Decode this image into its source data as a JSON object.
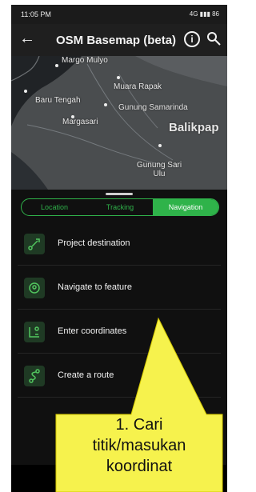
{
  "status": {
    "time": "11:05 PM",
    "right": "4G ▮▮▮ 86"
  },
  "appbar": {
    "back_icon": "arrow-left",
    "title": "OSM Basemap (beta)",
    "info_icon": "info-icon",
    "search_icon": "search-icon"
  },
  "map": {
    "labels": [
      "Margo Mulyo",
      "Muara Rapak",
      "Baru Tengah",
      "Gunung Samarinda",
      "Margasari",
      "Balikpap",
      "Gunung Sari Ulu"
    ]
  },
  "tabs": [
    "Location",
    "Tracking",
    "Navigation"
  ],
  "active_tab": "Navigation",
  "menu": [
    {
      "label": "Project destination",
      "icon": "project-destination-icon"
    },
    {
      "label": "Navigate to feature",
      "icon": "navigate-to-feature-icon"
    },
    {
      "label": "Enter coordinates",
      "icon": "enter-coordinates-icon"
    },
    {
      "label": "Create a route",
      "icon": "create-route-icon"
    }
  ],
  "annotation": {
    "lines": [
      "1. Cari",
      "titik/masukan",
      "koordinat"
    ]
  },
  "colors": {
    "accent": "#2fb34a",
    "note_bg": "#f6f24d"
  }
}
